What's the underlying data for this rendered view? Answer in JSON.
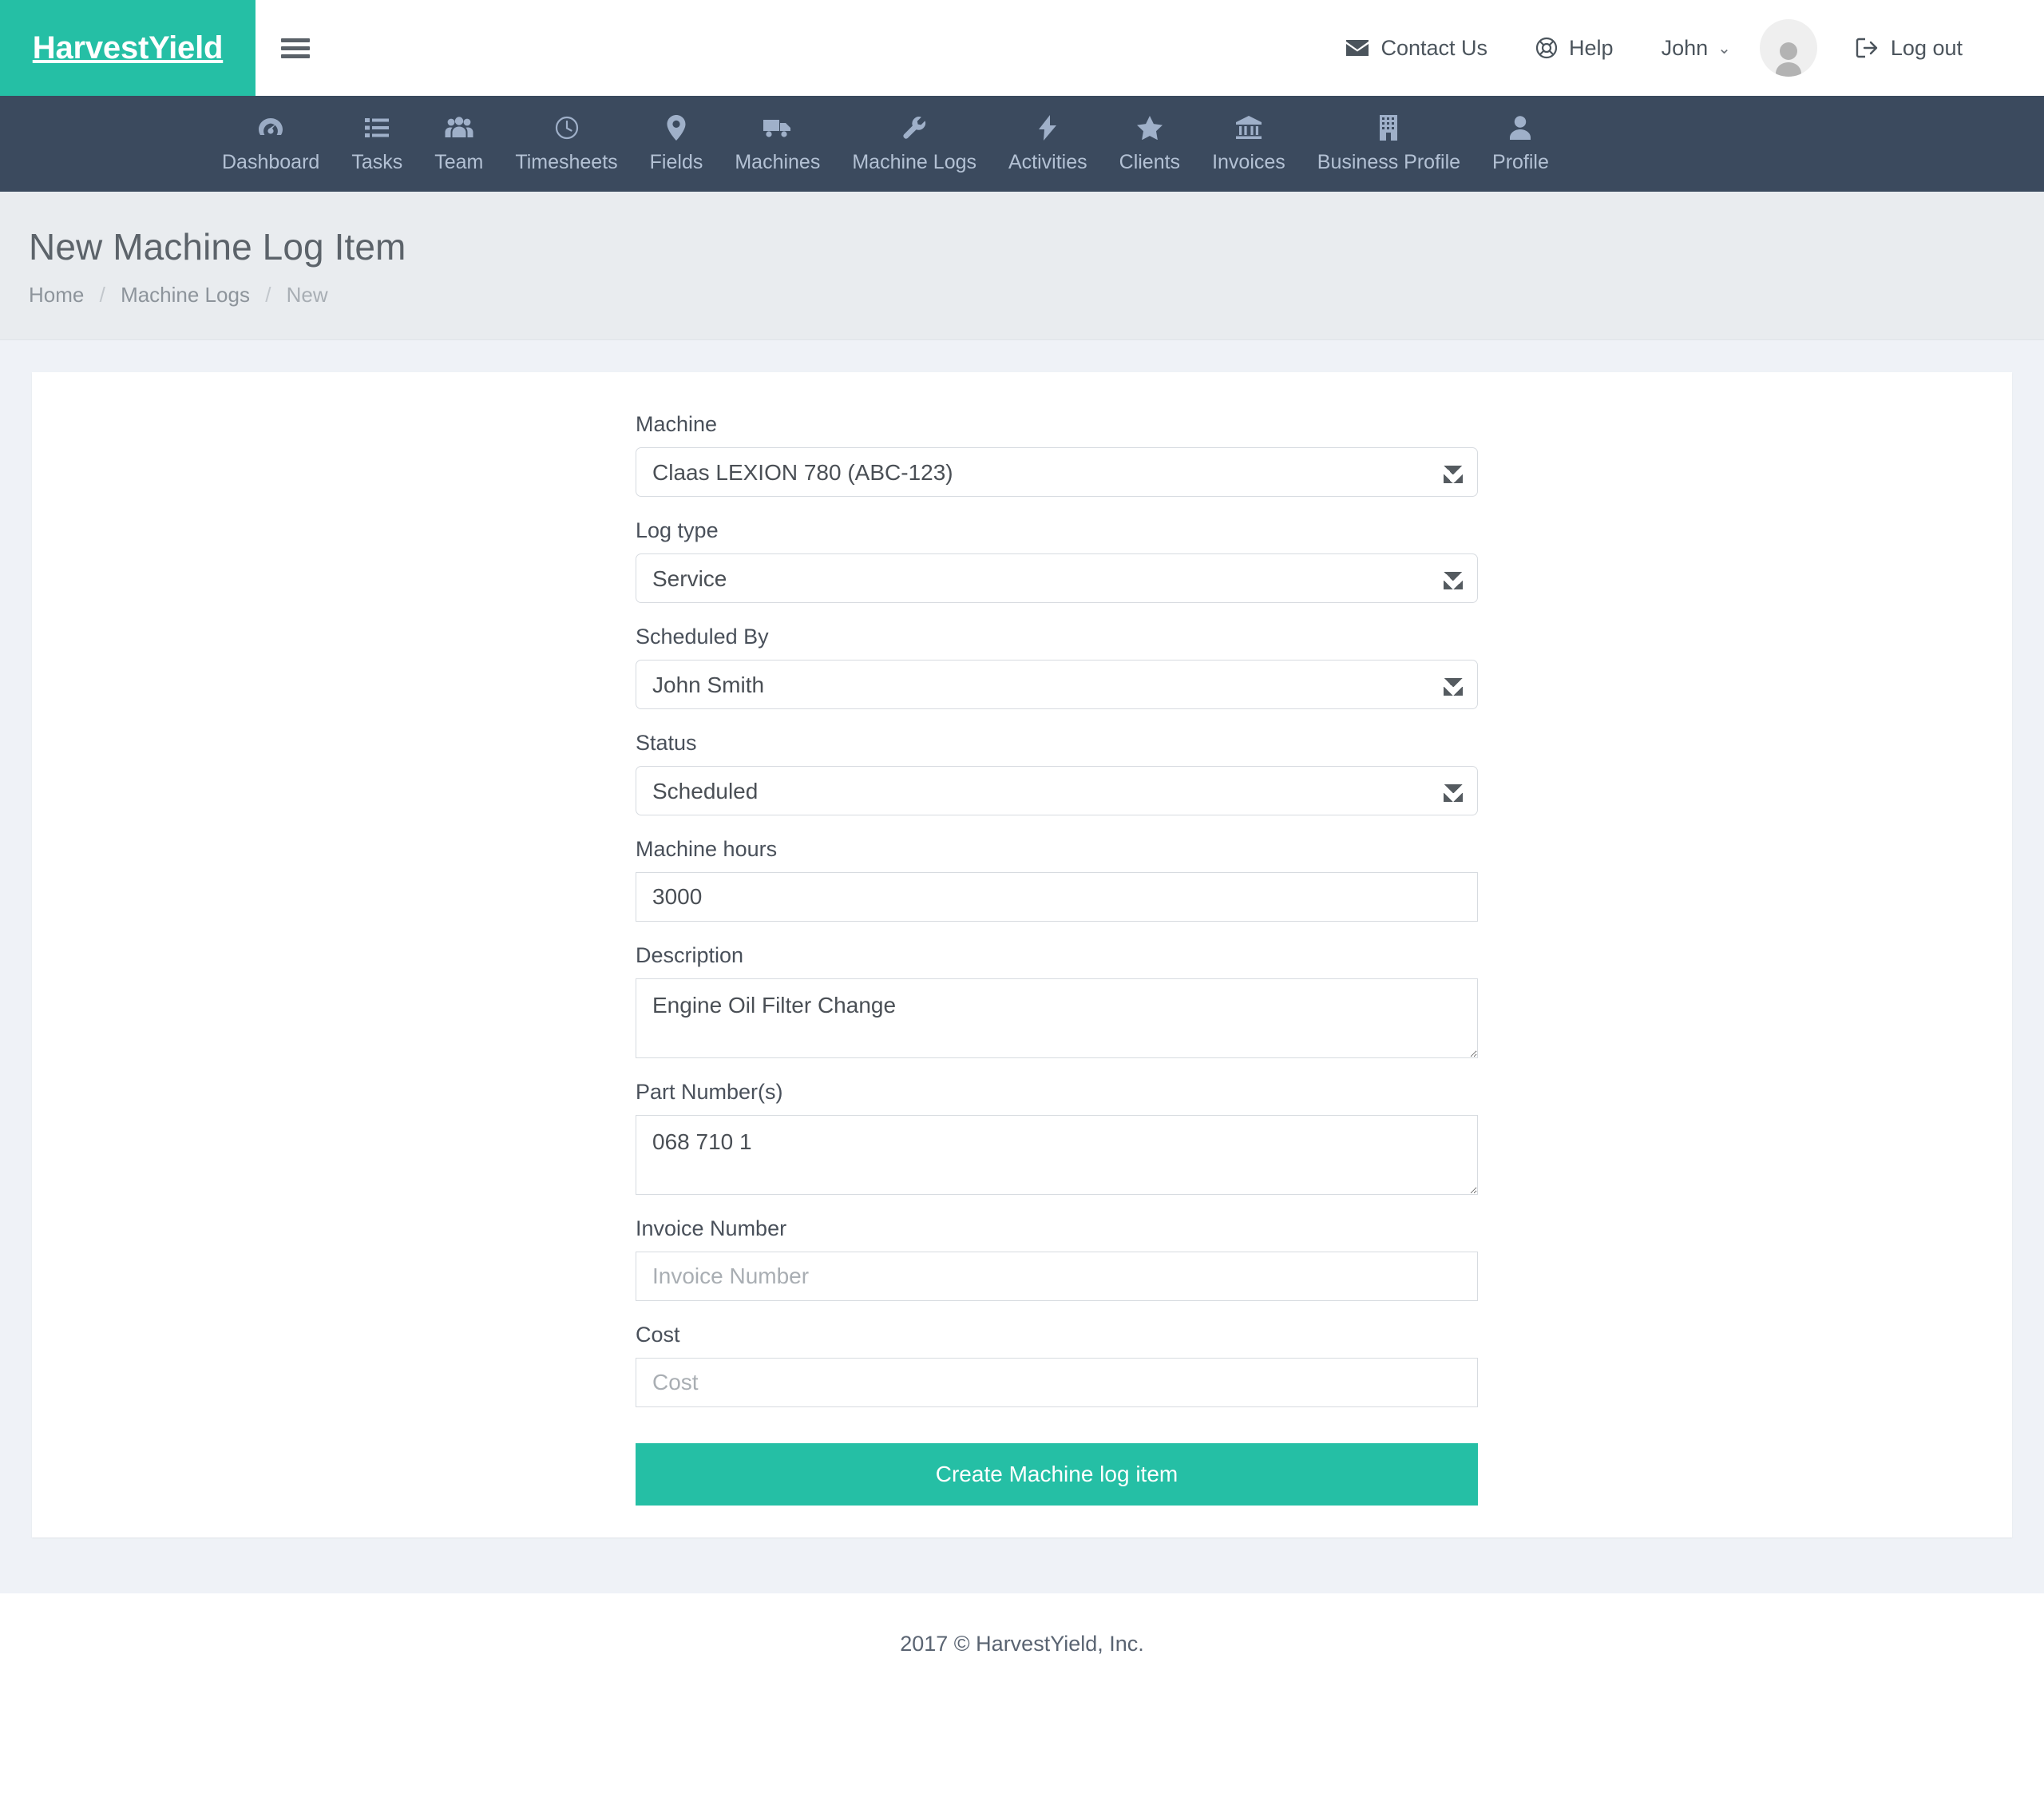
{
  "brand": {
    "name": "HarvestYield"
  },
  "topbar": {
    "menu_toggle": "menu-toggle",
    "contact_label": "Contact Us",
    "help_label": "Help",
    "user_label": "John",
    "logout_label": "Log out"
  },
  "nav": {
    "items": [
      {
        "label": "Dashboard",
        "icon": "dashboard-gauge-icon"
      },
      {
        "label": "Tasks",
        "icon": "list-icon"
      },
      {
        "label": "Team",
        "icon": "people-group-icon"
      },
      {
        "label": "Timesheets",
        "icon": "clock-icon"
      },
      {
        "label": "Fields",
        "icon": "map-pin-icon"
      },
      {
        "label": "Machines",
        "icon": "truck-icon"
      },
      {
        "label": "Machine Logs",
        "icon": "wrench-icon"
      },
      {
        "label": "Activities",
        "icon": "bolt-icon"
      },
      {
        "label": "Clients",
        "icon": "star-icon"
      },
      {
        "label": "Invoices",
        "icon": "bank-icon"
      },
      {
        "label": "Business Profile",
        "icon": "building-icon"
      },
      {
        "label": "Profile",
        "icon": "user-icon"
      }
    ]
  },
  "page": {
    "title": "New Machine Log Item",
    "breadcrumb": {
      "home": "Home",
      "section": "Machine Logs",
      "current": "New",
      "separator": "/"
    }
  },
  "form": {
    "machine": {
      "label": "Machine",
      "value": "Claas LEXION 780 (ABC-123)",
      "options": [
        "Claas LEXION 780 (ABC-123)"
      ]
    },
    "log_type": {
      "label": "Log type",
      "value": "Service",
      "options": [
        "Service"
      ]
    },
    "scheduled_by": {
      "label": "Scheduled By",
      "value": "John Smith",
      "options": [
        "John Smith"
      ]
    },
    "status": {
      "label": "Status",
      "value": "Scheduled",
      "options": [
        "Scheduled"
      ]
    },
    "machine_hours": {
      "label": "Machine hours",
      "value": "3000",
      "placeholder": "Machine hours"
    },
    "description": {
      "label": "Description",
      "value": "Engine Oil Filter Change",
      "placeholder": "Description"
    },
    "part_numbers": {
      "label": "Part Number(s)",
      "value": "068 710 1",
      "placeholder": "Part Number(s)"
    },
    "invoice_number": {
      "label": "Invoice Number",
      "value": "",
      "placeholder": "Invoice Number"
    },
    "cost": {
      "label": "Cost",
      "value": "",
      "placeholder": "Cost"
    },
    "submit_label": "Create Machine log item"
  },
  "footer": {
    "copyright": "2017 © HarvestYield, Inc."
  },
  "colors": {
    "brand_green": "#25bfa5",
    "navbar_dark": "#3b4a5e",
    "page_header_bg": "#e9ecef",
    "content_bg": "#eff2f7"
  }
}
